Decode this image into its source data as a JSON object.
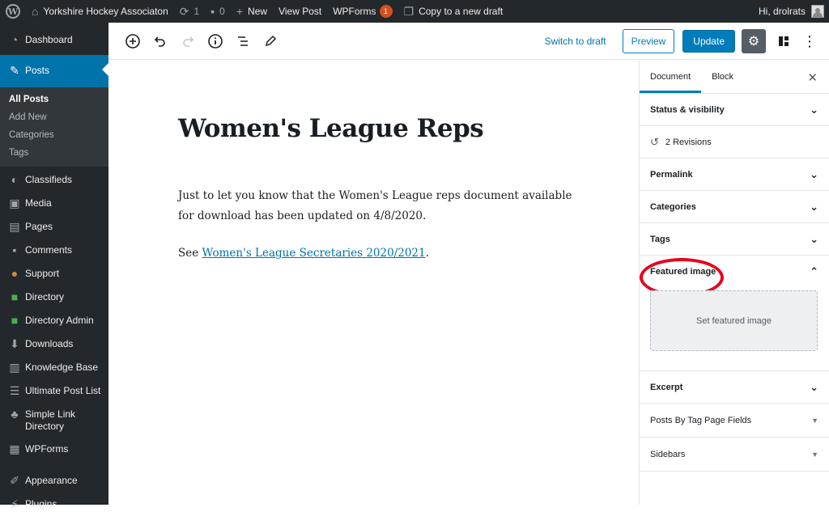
{
  "adminbar": {
    "site_name": "Yorkshire Hockey Associaton",
    "updates_count": "1",
    "comments_count": "0",
    "new_label": "New",
    "view_post": "View Post",
    "wpforms": "WPForms",
    "wpforms_badge": "1",
    "copy_draft": "Copy to a new draft",
    "greeting": "Hi, drolrats"
  },
  "menu": {
    "dashboard": "Dashboard",
    "posts": "Posts",
    "posts_sub": [
      "All Posts",
      "Add New",
      "Categories",
      "Tags"
    ],
    "classifieds": "Classifieds",
    "media": "Media",
    "pages": "Pages",
    "comments": "Comments",
    "support": "Support",
    "directory": "Directory",
    "directory_admin": "Directory Admin",
    "downloads": "Downloads",
    "knowledge_base": "Knowledge Base",
    "ultimate_post_list": "Ultimate Post List",
    "simple_link_directory": "Simple Link Directory",
    "wpforms": "WPForms",
    "appearance": "Appearance",
    "plugins": "Plugins"
  },
  "toolbar": {
    "switch_to_draft": "Switch to draft",
    "preview": "Preview",
    "update": "Update"
  },
  "post": {
    "title": "Women's League Reps",
    "paragraph1": "Just to let you know that the Women's League reps document available for download has been updated on 4/8/2020.",
    "paragraph2_prefix": "See ",
    "paragraph2_link": "Women's League Secretaries 2020/2021",
    "paragraph2_suffix": "."
  },
  "sidebar": {
    "tab_document": "Document",
    "tab_block": "Block",
    "status_visibility": "Status & visibility",
    "revisions": "2 Revisions",
    "permalink": "Permalink",
    "categories": "Categories",
    "tags": "Tags",
    "featured_image": "Featured image",
    "set_featured_image": "Set featured image",
    "excerpt": "Excerpt",
    "posts_by_tag": "Posts By Tag Page Fields",
    "sidebars": "Sidebars"
  },
  "colors": {
    "admin_dark": "#23282d",
    "accent": "#0073aa",
    "annotation": "#e8001c"
  }
}
